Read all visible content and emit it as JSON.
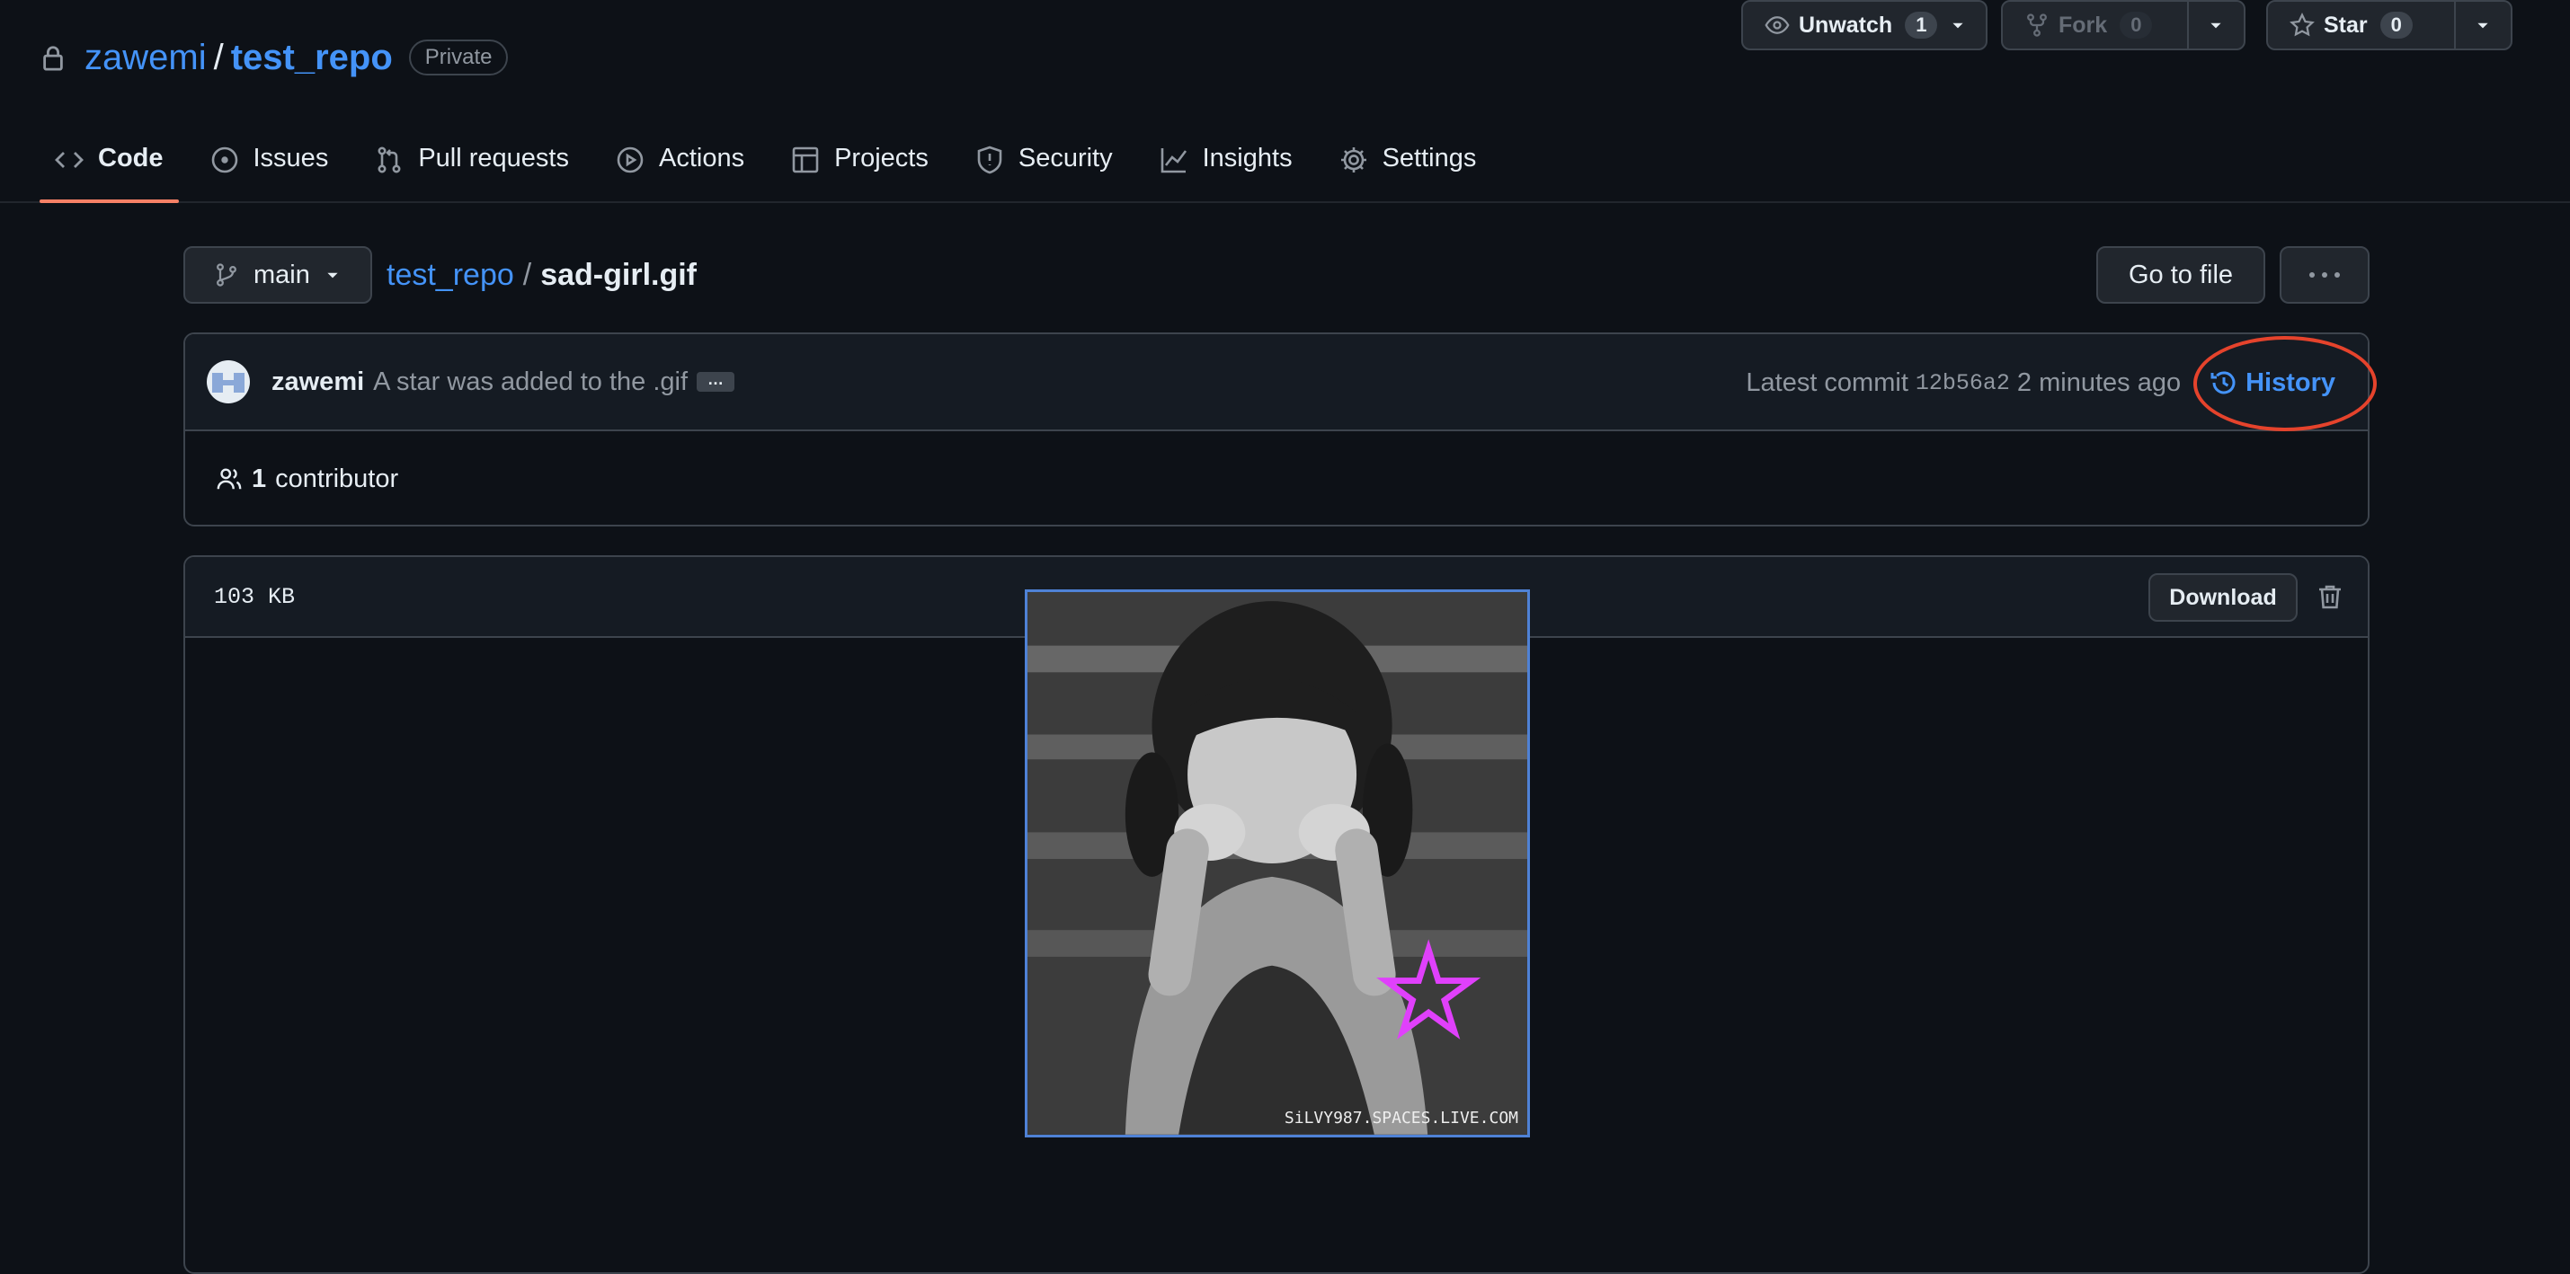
{
  "repo": {
    "owner": "zawemi",
    "separator": "/",
    "name": "test_repo",
    "visibility": "Private"
  },
  "actions": {
    "watch": {
      "label": "Unwatch",
      "count": "1"
    },
    "fork": {
      "label": "Fork",
      "count": "0"
    },
    "star": {
      "label": "Star",
      "count": "0"
    }
  },
  "nav": {
    "tabs": [
      {
        "label": "Code",
        "icon": "code-icon",
        "active": true
      },
      {
        "label": "Issues",
        "icon": "issue-icon"
      },
      {
        "label": "Pull requests",
        "icon": "pull-request-icon"
      },
      {
        "label": "Actions",
        "icon": "play-icon"
      },
      {
        "label": "Projects",
        "icon": "table-icon"
      },
      {
        "label": "Security",
        "icon": "shield-icon"
      },
      {
        "label": "Insights",
        "icon": "graph-icon"
      },
      {
        "label": "Settings",
        "icon": "gear-icon"
      }
    ]
  },
  "file_nav": {
    "branch": "main",
    "breadcrumb_repo": "test_repo",
    "breadcrumb_sep": "/",
    "file_name": "sad-girl.gif",
    "goto_file": "Go to file"
  },
  "commit": {
    "author": "zawemi",
    "message": "A star was added to the .gif",
    "ellipsis": "…",
    "latest_label": "Latest commit",
    "sha": "12b56a2",
    "time": "2 minutes ago",
    "history_label": "History",
    "contributors_count": "1",
    "contributors_label": "contributor"
  },
  "file": {
    "size": "103 KB",
    "download_label": "Download",
    "watermark": "SiLVY987.SPACES.LIVE.COM"
  },
  "colors": {
    "accent_link": "#4493f8",
    "active_tab_underline": "#f78166",
    "annotation_ring": "#e5432c",
    "star_overlay": "#e040fb"
  }
}
